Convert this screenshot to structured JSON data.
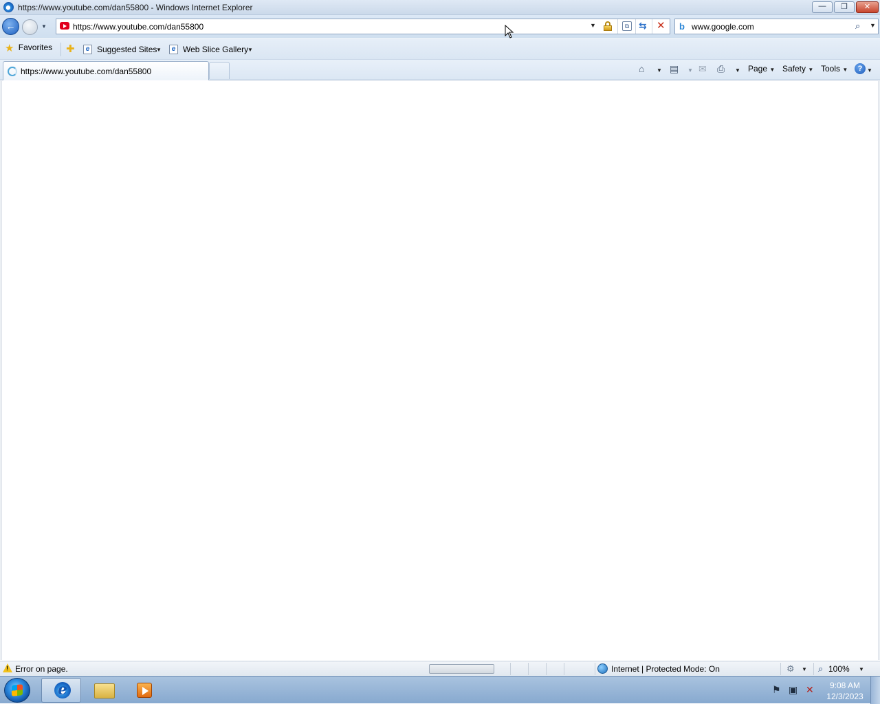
{
  "window": {
    "title": "https://www.youtube.com/dan55800 - Windows Internet Explorer",
    "minimize_icon": "minimize-icon",
    "restore_icon": "restore-icon",
    "close_icon": "close-icon"
  },
  "nav": {
    "address": "https://www.youtube.com/dan55800",
    "search_value": "www.google.com"
  },
  "favorites_bar": {
    "favorites_label": "Favorites",
    "suggested_sites_label": "Suggested Sites",
    "web_slice_gallery_label": "Web Slice Gallery"
  },
  "tabs": [
    {
      "label": "https://www.youtube.com/dan55800",
      "active": true
    }
  ],
  "command_bar": {
    "page_label": "Page",
    "safety_label": "Safety",
    "tools_label": "Tools"
  },
  "status_bar": {
    "message": "Error on page.",
    "zone": "Internet | Protected Mode: On",
    "zoom": "100%"
  },
  "taskbar": {
    "time": "9:08 AM",
    "date": "12/3/2023"
  },
  "colors": {
    "title_gradient_top": "#dfe9f5",
    "youtube_red": "#e1001e",
    "stop_red": "#c8321d",
    "favorites_star": "#e9b219"
  }
}
